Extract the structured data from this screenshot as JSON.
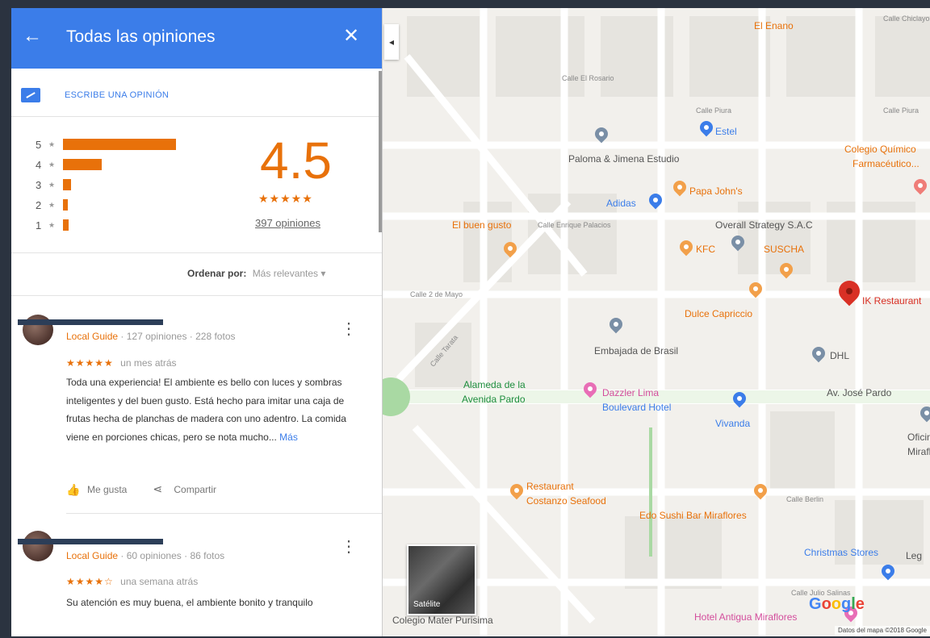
{
  "panel": {
    "title": "Todas las opiniones",
    "back_icon": "←",
    "close_icon": "✕",
    "write_review_label": "ESCRIBE UNA OPINIÓN",
    "average_rating": "4.5",
    "average_stars": "★★★★★",
    "review_count_label": "397 opiniones",
    "sort_label": "Ordenar por:",
    "sort_value": "Más relevantes ▾",
    "distribution": [
      {
        "stars": "5",
        "fraction": 1.0
      },
      {
        "stars": "4",
        "fraction": 0.34
      },
      {
        "stars": "3",
        "fraction": 0.07
      },
      {
        "stars": "2",
        "fraction": 0.03
      },
      {
        "stars": "1",
        "fraction": 0.05
      }
    ]
  },
  "reviews": [
    {
      "guide_label": "Local Guide",
      "stats": "· 127 opiniones · 228 fotos",
      "stars": "★★★★★",
      "time": "un mes atrás",
      "text": "Toda una experiencia! El ambiente es bello con luces y sombras inteligentes y del buen gusto. Está hecho para imitar una caja de frutas hecha de planchas de madera con uno adentro. La comida viene en porciones chicas, pero se nota mucho...",
      "more_label": "Más",
      "like_label": "Me gusta",
      "share_label": "Compartir"
    },
    {
      "guide_label": "Local Guide",
      "stats": "· 60 opiniones · 86 fotos",
      "stars": "★★★★☆",
      "time": "una semana atrás",
      "text": "Su atención es muy buena, el ambiente bonito y tranquilo"
    }
  ],
  "map": {
    "labels": {
      "el_enano": "El Enano",
      "calle_el_rosario": "Calle El Rosario",
      "calle_piura": "Calle Piura",
      "calle_piura_2": "Calle Piura",
      "calle_chiclayo": "Calle Chiclayo",
      "estel": "Estel",
      "paloma": "Paloma & Jimena Estudio",
      "colegio_quimico": "Colegio Químico",
      "farmaceutico": "Farmacéutico...",
      "adidas": "Adidas",
      "papa_johns": "Papa John's",
      "el_buen_gusto": "El buen gusto",
      "calle_enrique": "Calle Enrique Palacios",
      "overall": "Overall Strategy S.A.C",
      "kfc": "KFC",
      "suscha": "SUSCHA",
      "calle_2_mayo": "Calle 2 de Mayo",
      "dulce_capriccio": "Dulce Capriccio",
      "ik_restaurant": "IK Restaurant",
      "embajada": "Embajada de Brasil",
      "dhl": "DHL",
      "alameda_1": "Alameda de la",
      "alameda_2": "Avenida Pardo",
      "dazzler_1": "Dazzler Lima",
      "dazzler_2": "Boulevard Hotel",
      "av_jose_pardo": "Av. José Pardo",
      "vivanda": "Vivanda",
      "oficina_1": "Oficin",
      "oficina_2": "Miraflo",
      "restaurant_costanzo_1": "Restaurant",
      "restaurant_costanzo_2": "Costanzo Seafood",
      "edo_sushi": "Edo Sushi Bar Miraflores",
      "calle_berlin": "Calle Berlin",
      "christmas_stores": "Christmas Stores",
      "colegio_mater": "Colegio Mater Purisima",
      "hotel_antigua": "Hotel Antigua Miraflores",
      "calle_julio": "Calle Julio Salinas",
      "calle_tarata": "Calle Tarata",
      "leg": "Leg"
    },
    "satellite_label": "Satélite",
    "google_logo": "Google",
    "map_data_credit": "Datos del mapa ©2018 Google",
    "collapse_icon": "◂"
  }
}
